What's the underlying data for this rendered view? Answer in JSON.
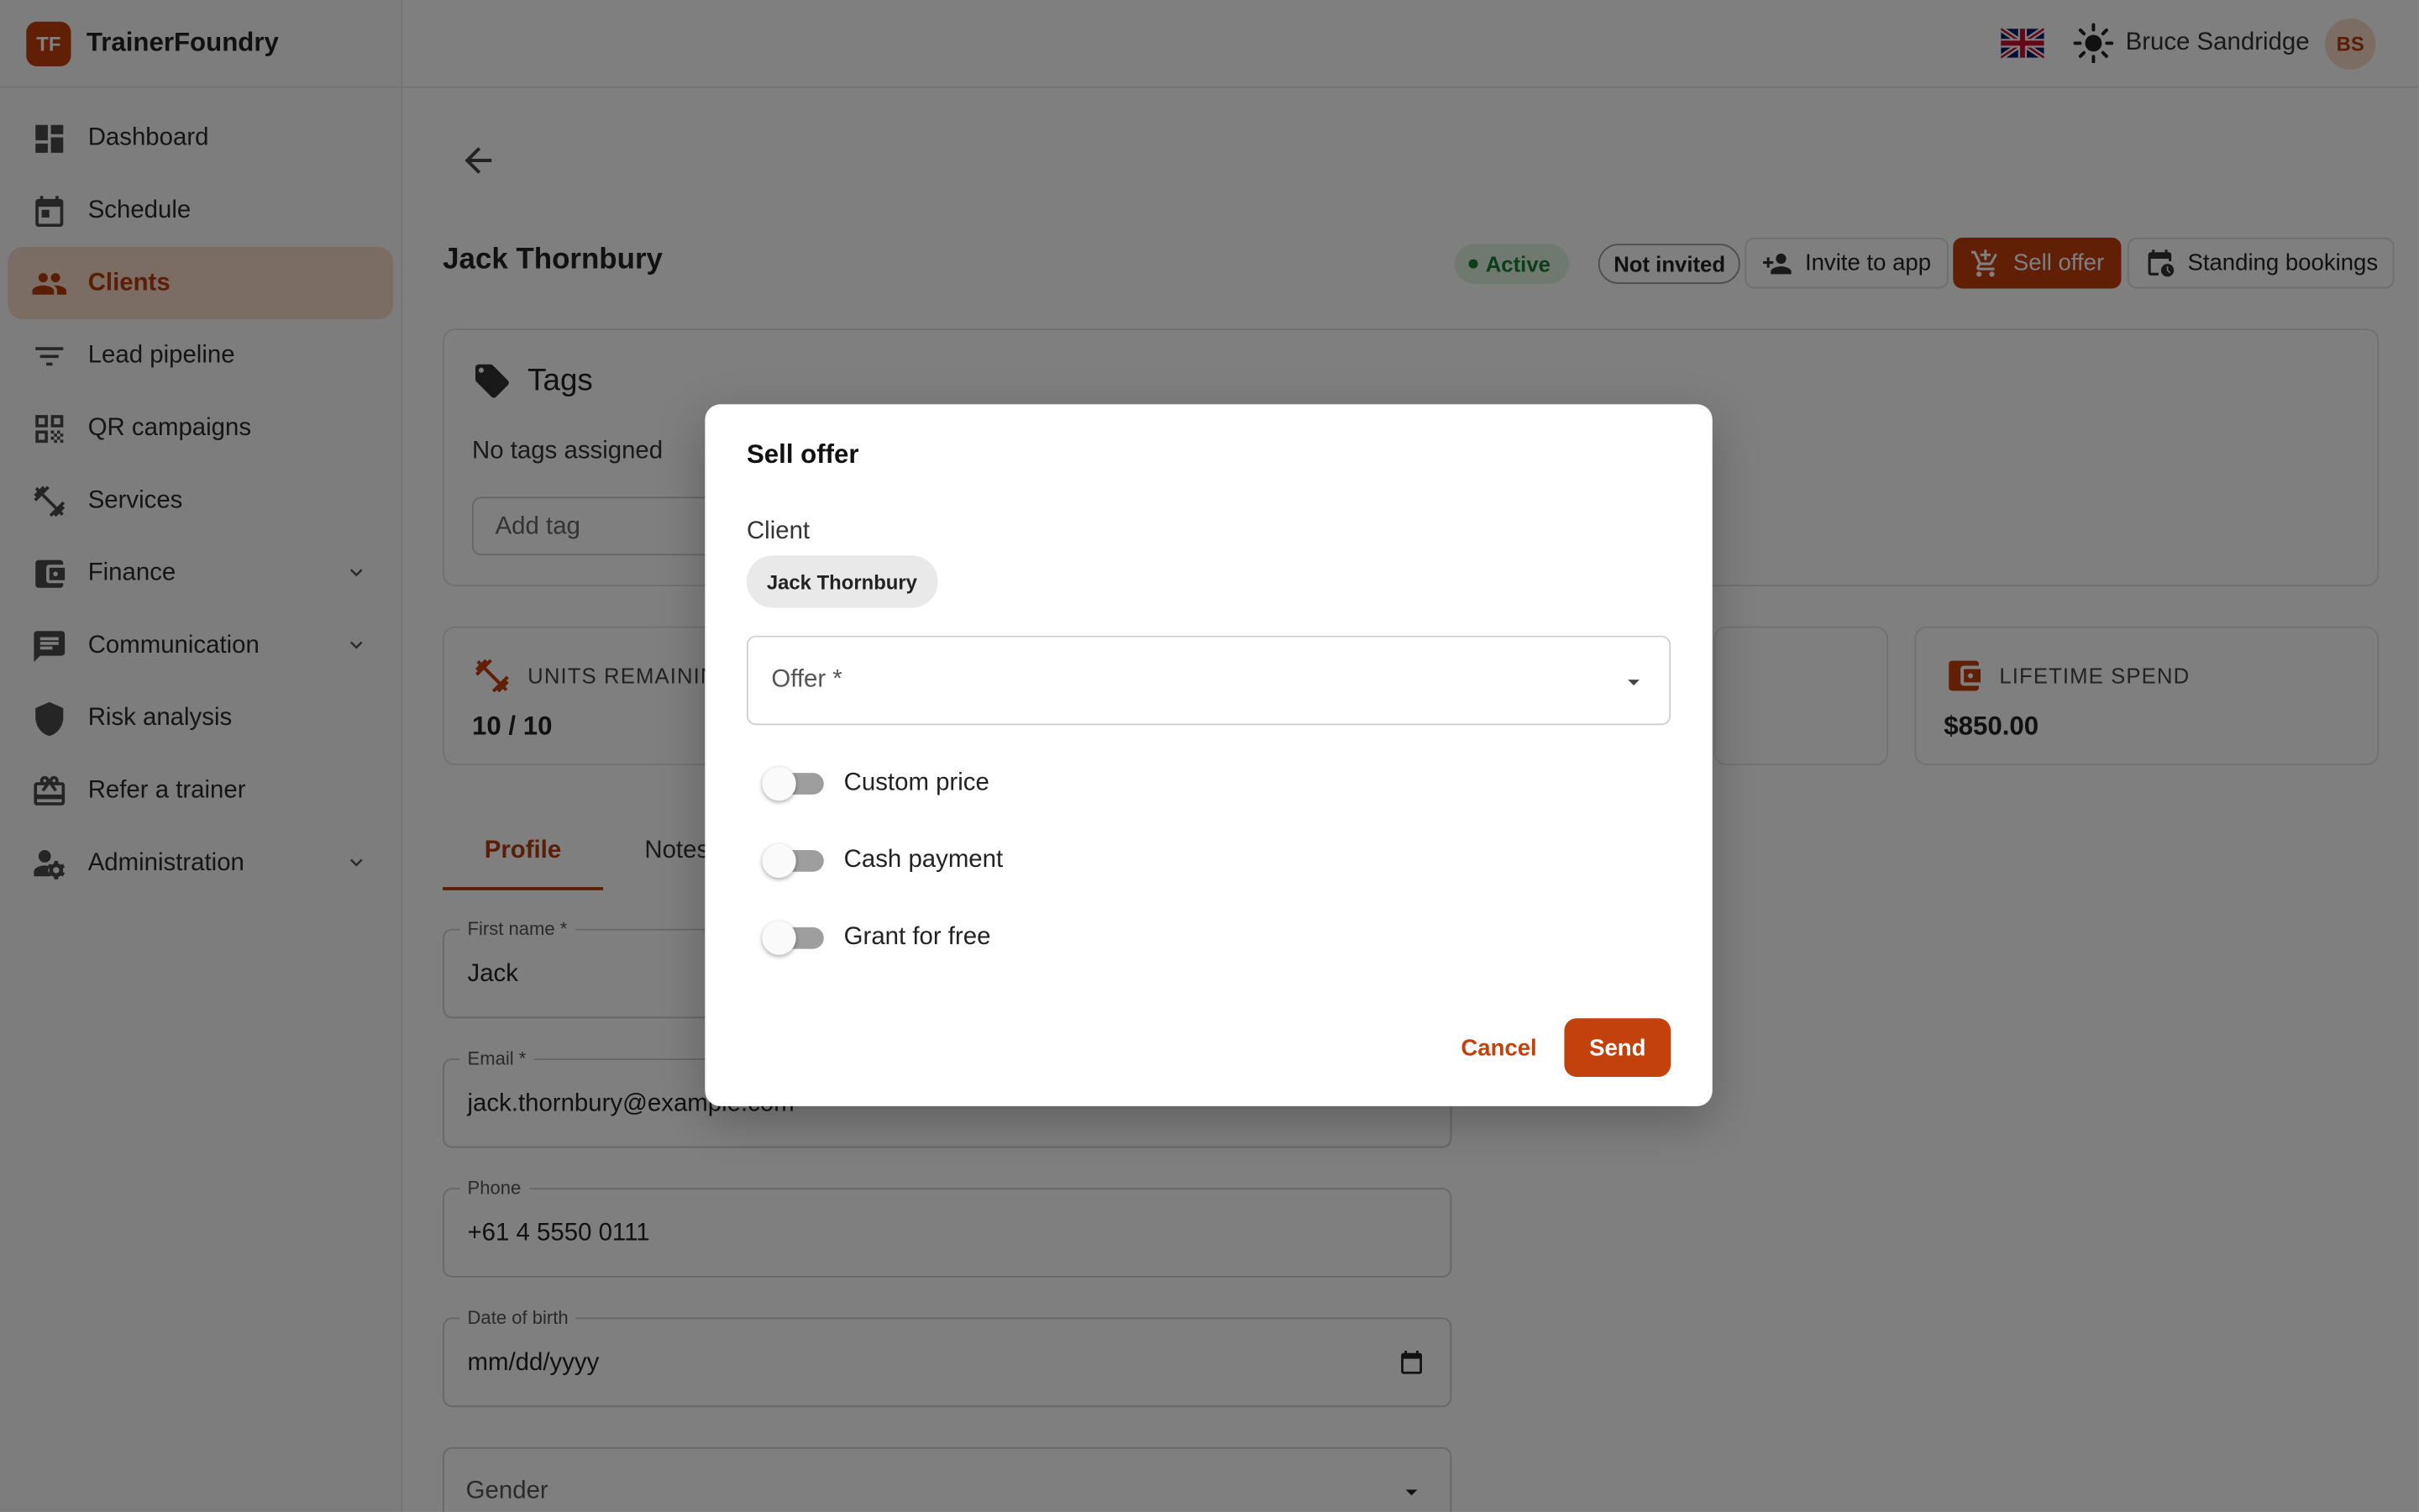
{
  "brand": {
    "logo": "TF",
    "name": "TrainerFoundry"
  },
  "sidebar": {
    "items": [
      {
        "label": "Dashboard",
        "icon": "dashboard-icon"
      },
      {
        "label": "Schedule",
        "icon": "calendar-icon"
      },
      {
        "label": "Clients",
        "icon": "people-icon",
        "active": true
      },
      {
        "label": "Lead pipeline",
        "icon": "filter-icon"
      },
      {
        "label": "QR campaigns",
        "icon": "qr-code-icon"
      },
      {
        "label": "Services",
        "icon": "fitness-icon"
      },
      {
        "label": "Finance",
        "icon": "wallet-icon",
        "expandable": true
      },
      {
        "label": "Communication",
        "icon": "chat-icon",
        "expandable": true
      },
      {
        "label": "Risk analysis",
        "icon": "shield-icon"
      },
      {
        "label": "Refer a trainer",
        "icon": "gift-icon"
      },
      {
        "label": "Administration",
        "icon": "admin-icon",
        "expandable": true
      }
    ]
  },
  "topbar": {
    "user_name": "Bruce Sandridge",
    "avatar_initials": "BS"
  },
  "client": {
    "name": "Jack Thornbury",
    "status": "Active",
    "invite_status": "Not invited",
    "actions": {
      "invite": "Invite to app",
      "sell": "Sell offer",
      "standing": "Standing bookings"
    }
  },
  "tags": {
    "title": "Tags",
    "empty": "No tags assigned",
    "add_placeholder": "Add tag"
  },
  "stats": {
    "units_label": "UNITS REMAININ",
    "units_value": "10 / 10",
    "lifetime_label": "LIFETIME SPEND",
    "lifetime_value": "$850.00"
  },
  "tabs": [
    {
      "label": "Profile",
      "active": true
    },
    {
      "label": "Notes"
    }
  ],
  "form": {
    "first_name_label": "First name *",
    "first_name": "Jack",
    "email_label": "Email *",
    "email": "jack.thornbury@example.com",
    "phone_label": "Phone",
    "phone": "+61 4 5550 0111",
    "dob_label": "Date of birth",
    "dob_placeholder": "mm/dd/yyyy",
    "gender_label": "Gender"
  },
  "dialog": {
    "title": "Sell offer",
    "client_label": "Client",
    "client_chip": "Jack Thornbury",
    "offer_label": "Offer *",
    "toggles": [
      {
        "label": "Custom price",
        "on": false
      },
      {
        "label": "Cash payment",
        "on": false
      },
      {
        "label": "Grant for free",
        "on": false
      }
    ],
    "cancel": "Cancel",
    "send": "Send"
  },
  "colors": {
    "accent": "#c2410c",
    "active_bg": "#f7d8c8",
    "status_green": "#1d7a32"
  }
}
